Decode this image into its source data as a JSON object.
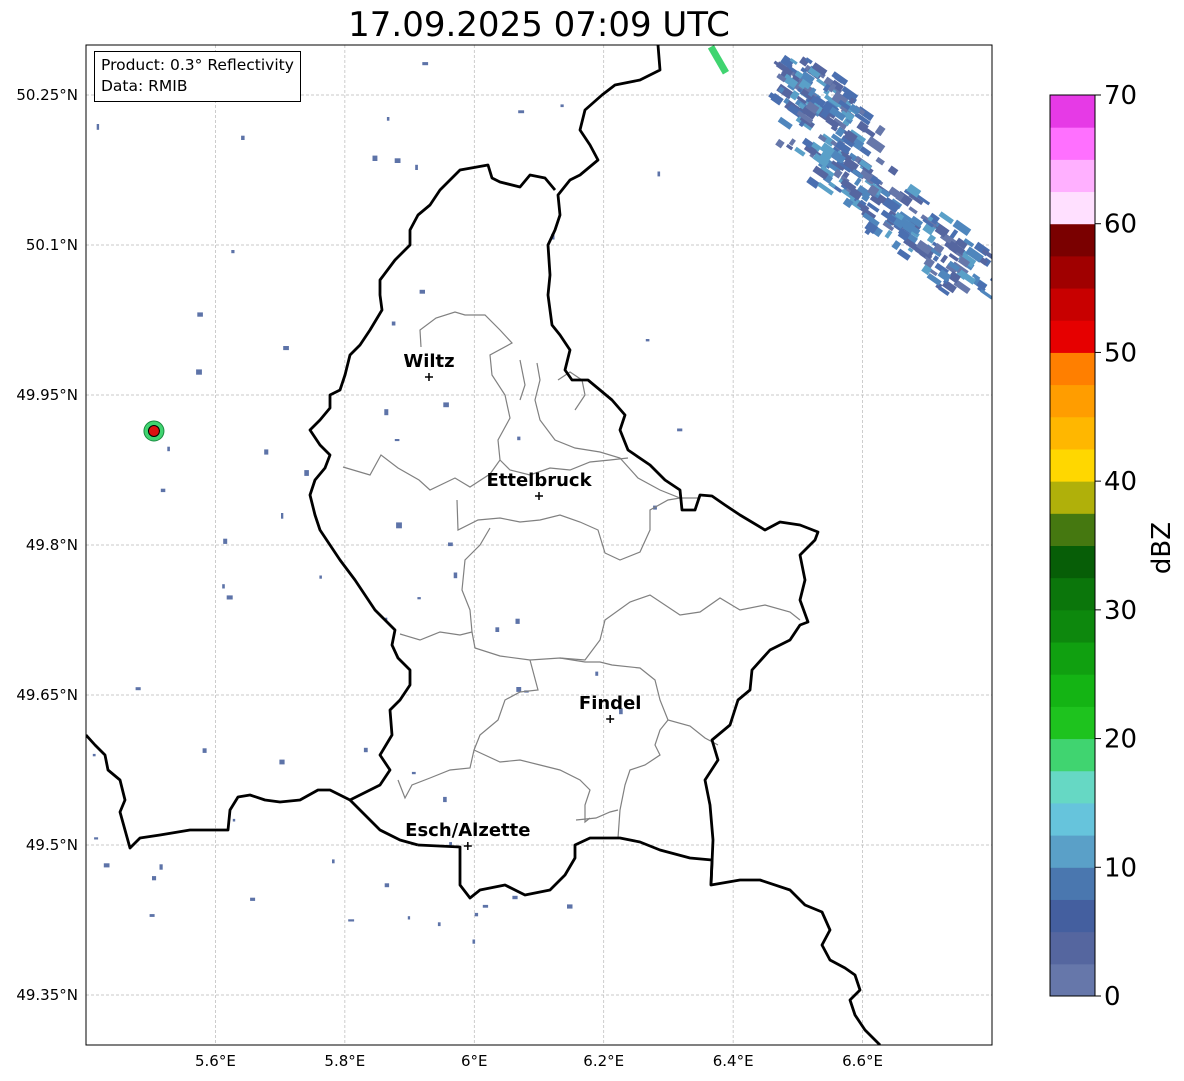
{
  "title": "17.09.2025 07:09 UTC",
  "info": {
    "product": "Product: 0.3° Reflectivity",
    "data_source": "Data: RMIB"
  },
  "map": {
    "lon_range": [
      5.4,
      6.8
    ],
    "lat_range": [
      49.3,
      50.3
    ],
    "lon_ticks": [
      {
        "value": 5.6,
        "label": "5.6°E"
      },
      {
        "value": 5.8,
        "label": "5.8°E"
      },
      {
        "value": 6.0,
        "label": "6°E"
      },
      {
        "value": 6.2,
        "label": "6.2°E"
      },
      {
        "value": 6.4,
        "label": "6.4°E"
      },
      {
        "value": 6.6,
        "label": "6.6°E"
      }
    ],
    "lat_ticks": [
      {
        "value": 50.25,
        "label": "50.25°N"
      },
      {
        "value": 50.1,
        "label": "50.1°N"
      },
      {
        "value": 49.95,
        "label": "49.95°N"
      },
      {
        "value": 49.8,
        "label": "49.8°N"
      },
      {
        "value": 49.65,
        "label": "49.65°N"
      },
      {
        "value": 49.5,
        "label": "49.5°N"
      },
      {
        "value": 49.35,
        "label": "49.35°N"
      }
    ],
    "grid": true,
    "cities": [
      {
        "name": "Wiltz",
        "lon": 5.93,
        "lat": 49.968
      },
      {
        "name": "Ettelbruck",
        "lon": 6.1,
        "lat": 49.849
      },
      {
        "name": "Findel",
        "lon": 6.21,
        "lat": 49.626
      },
      {
        "name": "Esch/Alzette",
        "lon": 5.99,
        "lat": 49.499
      }
    ],
    "radar_site": {
      "lon": 5.505,
      "lat": 49.914
    },
    "border_color": "#000000",
    "canton_color": "#808080"
  },
  "colorbar": {
    "label": "dBZ",
    "min": 0,
    "max": 70,
    "step": 2.5,
    "ticks": [
      0,
      10,
      20,
      30,
      40,
      50,
      60,
      70
    ],
    "colors": [
      "#6677aa",
      "#55669f",
      "#445f9f",
      "#4a77af",
      "#5aa0c8",
      "#66c4dc",
      "#66d8c4",
      "#40d470",
      "#1ec31e",
      "#14b414",
      "#10a010",
      "#0d880d",
      "#0b760b",
      "#075e07",
      "#457810",
      "#b0b00a",
      "#ffd700",
      "#ffb700",
      "#ff9d00",
      "#ff7f00",
      "#e60000",
      "#c80000",
      "#a00000",
      "#7a0000",
      "#ffe0ff",
      "#ffb0ff",
      "#ff70ff",
      "#e63ae6"
    ]
  }
}
